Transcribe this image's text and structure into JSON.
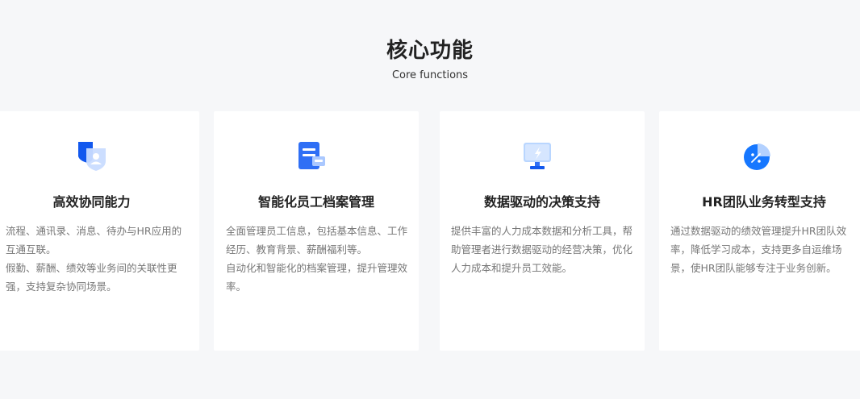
{
  "header": {
    "title": "核心功能",
    "subtitle": "Core functions"
  },
  "cards": [
    {
      "title": "高效协同能力",
      "icon": "shield-user-icon",
      "lines": [
        "流程、通讯录、消息、待办与HR应用的",
        "互通互联。",
        "假勤、薪酬、绩效等业务间的关联性更",
        "强，支持复杂协同场景。"
      ]
    },
    {
      "title": "智能化员工档案管理",
      "icon": "document-archive-icon",
      "lines": [
        "全面管理员工信息，包括基本信息、工作",
        "经历、教育背景、薪酬福利等。",
        "自动化和智能化的档案管理，提升管理效",
        "率。"
      ]
    },
    {
      "title": "数据驱动的决策支持",
      "icon": "monitor-data-icon",
      "lines": [
        "提供丰富的人力成本数据和分析工具，帮",
        "助管理者进行数据驱动的经营决策，优化",
        "人力成本和提升员工效能。"
      ]
    },
    {
      "title": "HR团队业务转型支持",
      "icon": "percent-pie-icon",
      "lines": [
        "通过数据驱动的绩效管理提升HR团队效",
        "率，降低学习成本，支持更多自运维场",
        "景，使HR团队能够专注于业务创新。"
      ]
    }
  ],
  "colors": {
    "background": "#f6f7f9",
    "card": "#ffffff",
    "accent_blue": "#1677ff",
    "light_blue": "#a9cbff"
  }
}
